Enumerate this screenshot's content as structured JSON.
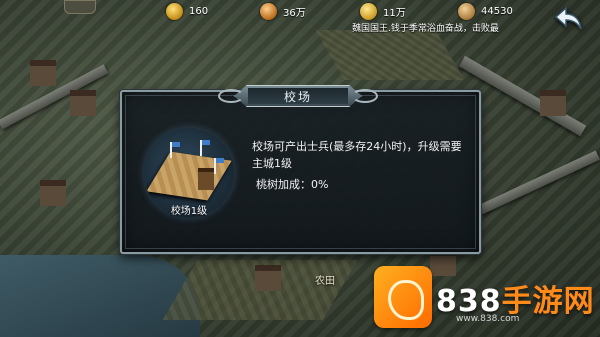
{
  "resources": [
    {
      "icon": "gold-ingot-icon",
      "value": "160"
    },
    {
      "icon": "food-icon",
      "value": "36万"
    },
    {
      "icon": "troops-icon",
      "value": "11万"
    },
    {
      "icon": "coin-icon",
      "value": "44530"
    }
  ],
  "marquee": "魏国国王.钱于季常浴血奋战，击败最",
  "map": {
    "label": "农田"
  },
  "dialog": {
    "title": "校场",
    "building_label": "校场1级",
    "description": "校场可产出士兵(最多存24小时)，升级需要主城1级",
    "bonus": "桃树加成：0%"
  },
  "watermark": {
    "brand": "838",
    "name": "手游网",
    "url": "www.838.com"
  },
  "colors": {
    "accent": "#ff8a1a",
    "panel_border": "#8a9aa1"
  }
}
